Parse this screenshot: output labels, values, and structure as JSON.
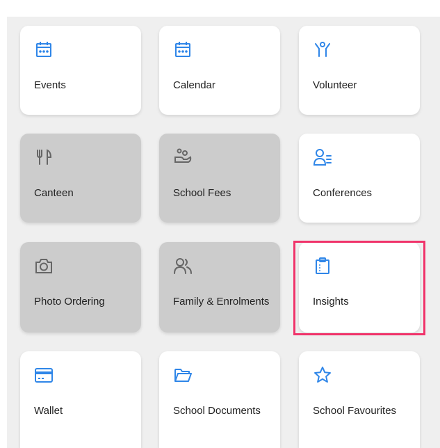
{
  "colors": {
    "accent_blue": "#2f86e8",
    "icon_grey": "#666666",
    "tile_white": "#ffffff",
    "tile_grey": "#cccccc",
    "highlight": "#f0336a"
  },
  "tiles": [
    {
      "label": "Events",
      "icon": "calendar-icon",
      "enabled": true
    },
    {
      "label": "Calendar",
      "icon": "calendar-icon",
      "enabled": true
    },
    {
      "label": "Volunteer",
      "icon": "volunteer-hands-icon",
      "enabled": true
    },
    {
      "label": "Canteen",
      "icon": "fork-knife-icon",
      "enabled": false
    },
    {
      "label": "School Fees",
      "icon": "hand-coins-icon",
      "enabled": false
    },
    {
      "label": "Conferences",
      "icon": "person-list-icon",
      "enabled": true
    },
    {
      "label": "Photo Ordering",
      "icon": "camera-icon",
      "enabled": false
    },
    {
      "label": "Family & Enrolments",
      "icon": "people-icon",
      "enabled": false
    },
    {
      "label": "Insights",
      "icon": "clipboard-icon",
      "enabled": true,
      "highlighted": true
    },
    {
      "label": "Wallet",
      "icon": "card-icon",
      "enabled": true
    },
    {
      "label": "School Documents",
      "icon": "folder-icon",
      "enabled": true
    },
    {
      "label": "School Favourites",
      "icon": "star-icon",
      "enabled": true
    }
  ]
}
